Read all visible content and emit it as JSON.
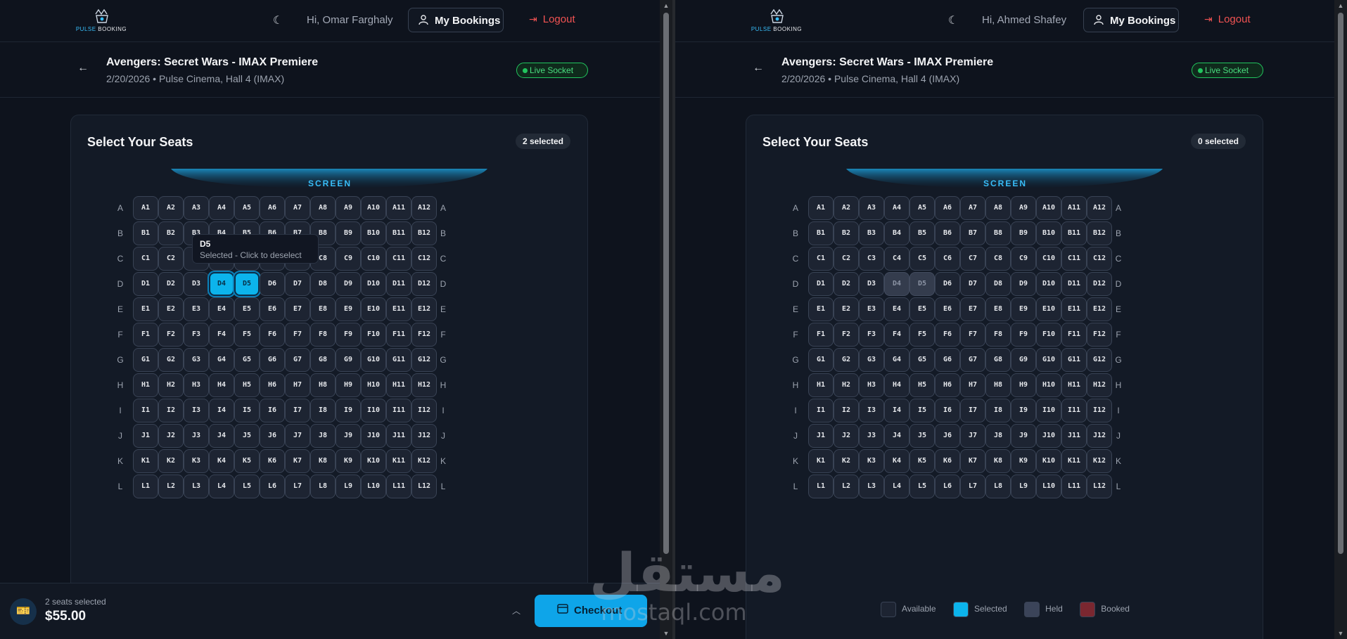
{
  "app": {
    "logo_a": "PULSE",
    "logo_b": " BOOKING",
    "my_bookings": "My Bookings",
    "logout": "Logout"
  },
  "event": {
    "title": "Avengers: Secret Wars - IMAX Premiere",
    "subtitle": "2/20/2026 • Pulse Cinema, Hall 4 (IMAX)",
    "live_label": "Live Socket"
  },
  "seating": {
    "title": "Select Your Seats",
    "screen_label": "SCREEN",
    "rows": [
      "A",
      "B",
      "C",
      "D",
      "E",
      "F",
      "G",
      "H",
      "I",
      "J",
      "K",
      "L"
    ],
    "seats_per_row": 12
  },
  "panes": [
    {
      "greeting": "Hi, Omar Farghaly",
      "selected_badge": "2 selected",
      "selected": [
        "D4",
        "D5"
      ],
      "held": [],
      "tooltip": {
        "seat": "D4",
        "title": "D5",
        "text": "Selected - Click to deselect"
      },
      "bottom": {
        "count": "2 seats selected",
        "total": "$55.00",
        "checkout": "Checkout"
      }
    },
    {
      "greeting": "Hi, Ahmed Shafey",
      "selected_badge": "0 selected",
      "selected": [],
      "held": [
        "D4",
        "D5"
      ],
      "legend": [
        {
          "label": "Available",
          "color": "#1d2432"
        },
        {
          "label": "Selected",
          "color": "#0cb4ec"
        },
        {
          "label": "Held",
          "color": "#3b4459"
        },
        {
          "label": "Booked",
          "color": "#7a2730"
        }
      ]
    }
  ],
  "watermark": {
    "arabic": "مستقل",
    "latin": "mostaql.com"
  },
  "colors": {
    "accent": "#0ea5e9",
    "danger": "#f05252",
    "live": "#22c55e"
  }
}
